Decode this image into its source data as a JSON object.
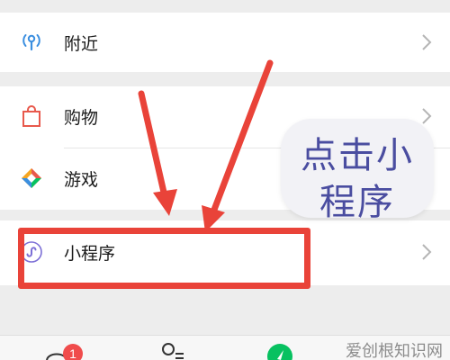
{
  "menu": {
    "nearby_label": "附近",
    "shopping_label": "购物",
    "games_label": "游戏",
    "miniprogram_label": "小程序"
  },
  "annotation": {
    "line1": "点击小",
    "line2": "程序"
  },
  "tabbar": {
    "chats_badge": "1"
  },
  "watermark": "爱创根知识网",
  "colors": {
    "arrow": "#e94339",
    "annotation_text": "#4a4da0",
    "badge": "#f04c4c",
    "accent_green": "#07c160"
  }
}
